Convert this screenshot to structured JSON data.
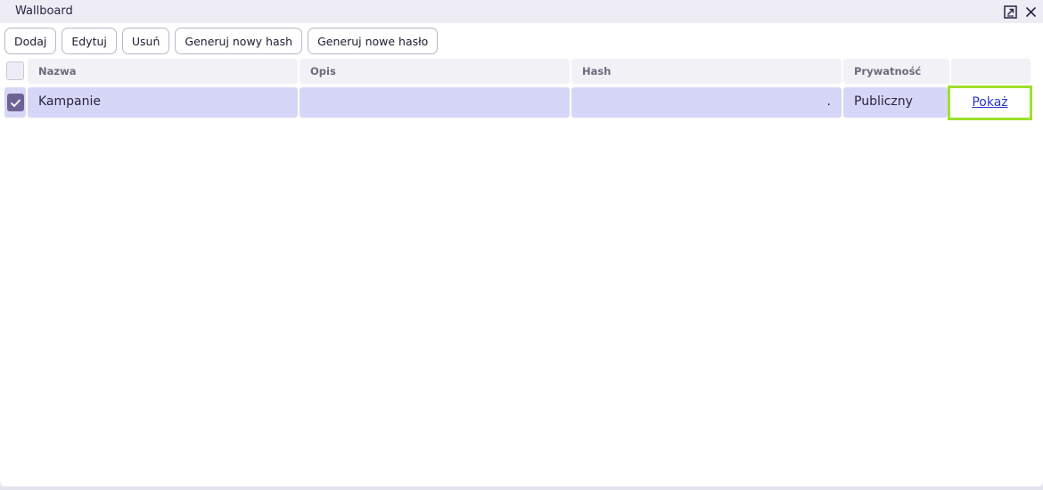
{
  "window": {
    "title": "Wallboard",
    "popout_icon": "popout-icon",
    "close_icon": "close-icon"
  },
  "toolbar": {
    "add_label": "Dodaj",
    "edit_label": "Edytuj",
    "delete_label": "Usuń",
    "generate_hash_label": "Generuj nowy hash",
    "generate_password_label": "Generuj nowe hasło"
  },
  "table": {
    "columns": [
      "Nazwa",
      "Opis",
      "Hash",
      "Prywatność",
      ""
    ],
    "rows": [
      {
        "checked": true,
        "name": "Kampanie",
        "description": "",
        "hash": ".",
        "privacy": "Publiczny",
        "action_label": "Pokaż"
      }
    ]
  },
  "colors": {
    "titlebar": "#eeedf6",
    "selected_row": "#d6d6f7",
    "checkbox_checked": "#6f6396",
    "highlight_border": "#9fe02a",
    "link": "#2b35c9"
  }
}
